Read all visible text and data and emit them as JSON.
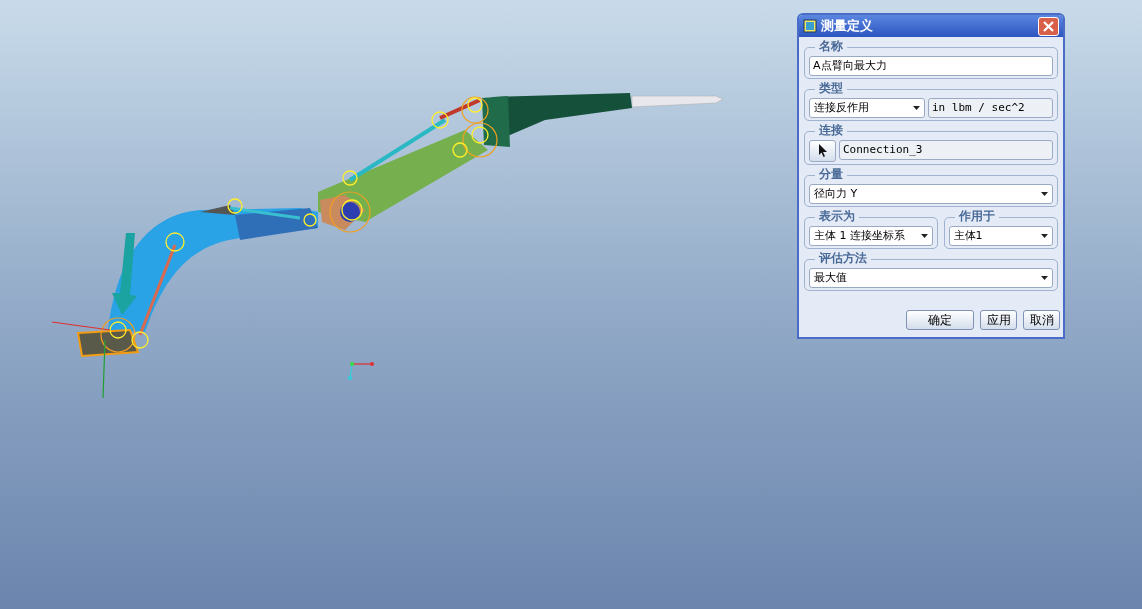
{
  "dialog": {
    "title": "测量定义",
    "name": {
      "label": "名称",
      "value": "A点臂向最大力"
    },
    "type": {
      "label": "类型",
      "selection": "连接反作用",
      "units": "in lbm / sec^2"
    },
    "connection": {
      "label": "连接",
      "value": "Connection_3"
    },
    "component": {
      "label": "分量",
      "selection": "径向力 Y"
    },
    "express_as": {
      "label": "表示为",
      "selection": "主体 1 连接坐标系"
    },
    "applies_to": {
      "label": "作用于",
      "selection": "主体1"
    },
    "evaluation": {
      "label": "评估方法",
      "selection": "最大值"
    },
    "buttons": [
      {
        "kind": "ok",
        "label": "确定"
      },
      {
        "kind": "apply",
        "label": "应用"
      },
      {
        "kind": "cancel",
        "label": "取消"
      }
    ]
  }
}
